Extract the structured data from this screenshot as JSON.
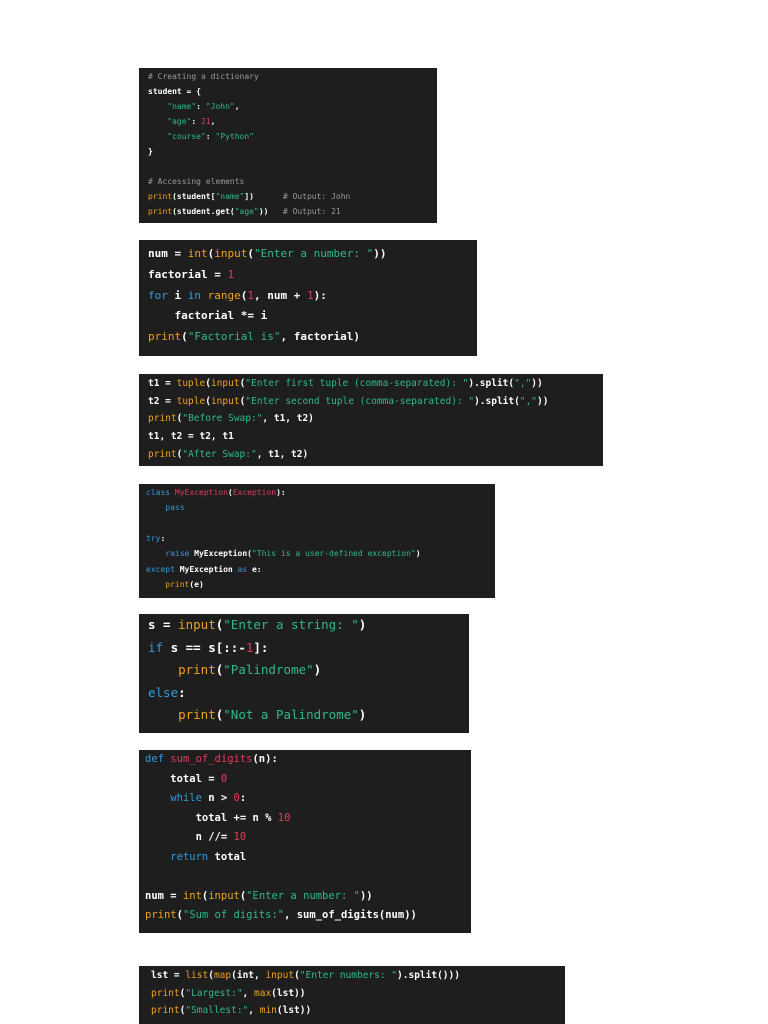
{
  "blocks": [
    {
      "lines": [
        [
          [
            "com",
            "# Creating a dictionary"
          ]
        ],
        [
          [
            "plain",
            "student = {"
          ]
        ],
        [
          [
            "plain",
            "    "
          ],
          [
            "str",
            "\"name\""
          ],
          [
            "plain",
            ": "
          ],
          [
            "str",
            "\"John\""
          ],
          [
            "plain",
            ","
          ]
        ],
        [
          [
            "plain",
            "    "
          ],
          [
            "str",
            "\"age\""
          ],
          [
            "plain",
            ": "
          ],
          [
            "num",
            "21"
          ],
          [
            "plain",
            ","
          ]
        ],
        [
          [
            "plain",
            "    "
          ],
          [
            "str",
            "\"course\""
          ],
          [
            "plain",
            ": "
          ],
          [
            "str",
            "\"Python\""
          ]
        ],
        [
          [
            "plain",
            "}"
          ]
        ],
        [],
        [
          [
            "com",
            "# Accessing elements"
          ]
        ],
        [
          [
            "fn",
            "print"
          ],
          [
            "plain",
            "(student["
          ],
          [
            "str",
            "\"name\""
          ],
          [
            "plain",
            "])      "
          ],
          [
            "com",
            "# Output: John"
          ]
        ],
        [
          [
            "fn",
            "print"
          ],
          [
            "plain",
            "(student.get("
          ],
          [
            "str",
            "\"age\""
          ],
          [
            "plain",
            "))   "
          ],
          [
            "com",
            "# Output: 21"
          ]
        ]
      ]
    },
    {
      "lines": [
        [
          [
            "plain",
            "num = "
          ],
          [
            "fn",
            "int"
          ],
          [
            "plain",
            "("
          ],
          [
            "fn",
            "input"
          ],
          [
            "plain",
            "("
          ],
          [
            "str",
            "\"Enter a number: \""
          ],
          [
            "plain",
            "))"
          ]
        ],
        [
          [
            "plain",
            "factorial = "
          ],
          [
            "num",
            "1"
          ]
        ],
        [
          [
            "kw",
            "for"
          ],
          [
            "plain",
            " i "
          ],
          [
            "kw",
            "in"
          ],
          [
            "plain",
            " "
          ],
          [
            "fn",
            "range"
          ],
          [
            "plain",
            "("
          ],
          [
            "num",
            "1"
          ],
          [
            "plain",
            ", num + "
          ],
          [
            "num",
            "1"
          ],
          [
            "plain",
            "):"
          ]
        ],
        [
          [
            "plain",
            "    factorial *= i"
          ]
        ],
        [
          [
            "fn",
            "print"
          ],
          [
            "plain",
            "("
          ],
          [
            "str",
            "\"Factorial is\""
          ],
          [
            "plain",
            ", factorial)"
          ]
        ]
      ]
    },
    {
      "lines": [
        [
          [
            "plain",
            "t1 = "
          ],
          [
            "fn",
            "tuple"
          ],
          [
            "plain",
            "("
          ],
          [
            "fn",
            "input"
          ],
          [
            "plain",
            "("
          ],
          [
            "str",
            "\"Enter first tuple (comma-separated): \""
          ],
          [
            "plain",
            ").split("
          ],
          [
            "str",
            "\",\""
          ],
          [
            "plain",
            "))"
          ]
        ],
        [
          [
            "plain",
            "t2 = "
          ],
          [
            "fn",
            "tuple"
          ],
          [
            "plain",
            "("
          ],
          [
            "fn",
            "input"
          ],
          [
            "plain",
            "("
          ],
          [
            "str",
            "\"Enter second tuple (comma-separated): \""
          ],
          [
            "plain",
            ").split("
          ],
          [
            "str",
            "\",\""
          ],
          [
            "plain",
            "))"
          ]
        ],
        [
          [
            "fn",
            "print"
          ],
          [
            "plain",
            "("
          ],
          [
            "str",
            "\"Before Swap:\""
          ],
          [
            "plain",
            ", t1, t2)"
          ]
        ],
        [
          [
            "plain",
            "t1, t2 = t2, t1"
          ]
        ],
        [
          [
            "fn",
            "print"
          ],
          [
            "plain",
            "("
          ],
          [
            "str",
            "\"After Swap:\""
          ],
          [
            "plain",
            ", t1, t2)"
          ]
        ]
      ]
    },
    {
      "lines": [
        [
          [
            "kw",
            "class"
          ],
          [
            "plain",
            " "
          ],
          [
            "cls",
            "MyException"
          ],
          [
            "plain",
            "("
          ],
          [
            "cls",
            "Exception"
          ],
          [
            "plain",
            "):"
          ]
        ],
        [
          [
            "plain",
            "    "
          ],
          [
            "kw",
            "pass"
          ]
        ],
        [],
        [
          [
            "kw",
            "try"
          ],
          [
            "plain",
            ":"
          ]
        ],
        [
          [
            "plain",
            "    "
          ],
          [
            "kw",
            "raise"
          ],
          [
            "plain",
            " MyException("
          ],
          [
            "str",
            "\"This is a user-defined exception\""
          ],
          [
            "plain",
            ")"
          ]
        ],
        [
          [
            "kw",
            "except"
          ],
          [
            "plain",
            " MyException "
          ],
          [
            "kw",
            "as"
          ],
          [
            "plain",
            " e:"
          ]
        ],
        [
          [
            "plain",
            "    "
          ],
          [
            "fn",
            "print"
          ],
          [
            "plain",
            "(e)"
          ]
        ]
      ]
    },
    {
      "lines": [
        [
          [
            "plain",
            "s = "
          ],
          [
            "fn",
            "input"
          ],
          [
            "plain",
            "("
          ],
          [
            "str",
            "\"Enter a string: \""
          ],
          [
            "plain",
            ")"
          ]
        ],
        [
          [
            "kw",
            "if"
          ],
          [
            "plain",
            " s == s[::-"
          ],
          [
            "num",
            "1"
          ],
          [
            "plain",
            "]:"
          ]
        ],
        [
          [
            "plain",
            "    "
          ],
          [
            "fn",
            "print"
          ],
          [
            "plain",
            "("
          ],
          [
            "str",
            "\"Palindrome\""
          ],
          [
            "plain",
            ")"
          ]
        ],
        [
          [
            "kw",
            "else"
          ],
          [
            "plain",
            ":"
          ]
        ],
        [
          [
            "plain",
            "    "
          ],
          [
            "fn",
            "print"
          ],
          [
            "plain",
            "("
          ],
          [
            "str",
            "\"Not a Palindrome\""
          ],
          [
            "plain",
            ")"
          ]
        ]
      ]
    },
    {
      "lines": [
        [
          [
            "kw",
            "def"
          ],
          [
            "plain",
            " "
          ],
          [
            "cls",
            "sum_of_digits"
          ],
          [
            "plain",
            "(n):"
          ]
        ],
        [
          [
            "plain",
            "    total = "
          ],
          [
            "num",
            "0"
          ]
        ],
        [
          [
            "plain",
            "    "
          ],
          [
            "kw",
            "while"
          ],
          [
            "plain",
            " n > "
          ],
          [
            "num",
            "0"
          ],
          [
            "plain",
            ":"
          ]
        ],
        [
          [
            "plain",
            "        total += n % "
          ],
          [
            "num",
            "10"
          ]
        ],
        [
          [
            "plain",
            "        n //= "
          ],
          [
            "num",
            "10"
          ]
        ],
        [
          [
            "plain",
            "    "
          ],
          [
            "kw",
            "return"
          ],
          [
            "plain",
            " total"
          ]
        ],
        [],
        [
          [
            "plain",
            "num = "
          ],
          [
            "fn",
            "int"
          ],
          [
            "plain",
            "("
          ],
          [
            "fn",
            "input"
          ],
          [
            "plain",
            "("
          ],
          [
            "str",
            "\"Enter a number: \""
          ],
          [
            "plain",
            "))"
          ]
        ],
        [
          [
            "fn",
            "print"
          ],
          [
            "plain",
            "("
          ],
          [
            "str",
            "\"Sum of digits:\""
          ],
          [
            "plain",
            ", sum_of_digits(num))"
          ]
        ]
      ]
    },
    {
      "lines": [
        [
          [
            "plain",
            "lst = "
          ],
          [
            "fn",
            "list"
          ],
          [
            "plain",
            "("
          ],
          [
            "fn",
            "map"
          ],
          [
            "plain",
            "(int, "
          ],
          [
            "fn",
            "input"
          ],
          [
            "plain",
            "("
          ],
          [
            "str",
            "\"Enter numbers: \""
          ],
          [
            "plain",
            ").split()))"
          ]
        ],
        [
          [
            "fn",
            "print"
          ],
          [
            "plain",
            "("
          ],
          [
            "str",
            "\"Largest:\""
          ],
          [
            "plain",
            ", "
          ],
          [
            "fn",
            "max"
          ],
          [
            "plain",
            "(lst))"
          ]
        ],
        [
          [
            "fn",
            "print"
          ],
          [
            "plain",
            "("
          ],
          [
            "str",
            "\"Smallest:\""
          ],
          [
            "plain",
            ", "
          ],
          [
            "fn",
            "min"
          ],
          [
            "plain",
            "(lst))"
          ]
        ]
      ]
    }
  ]
}
